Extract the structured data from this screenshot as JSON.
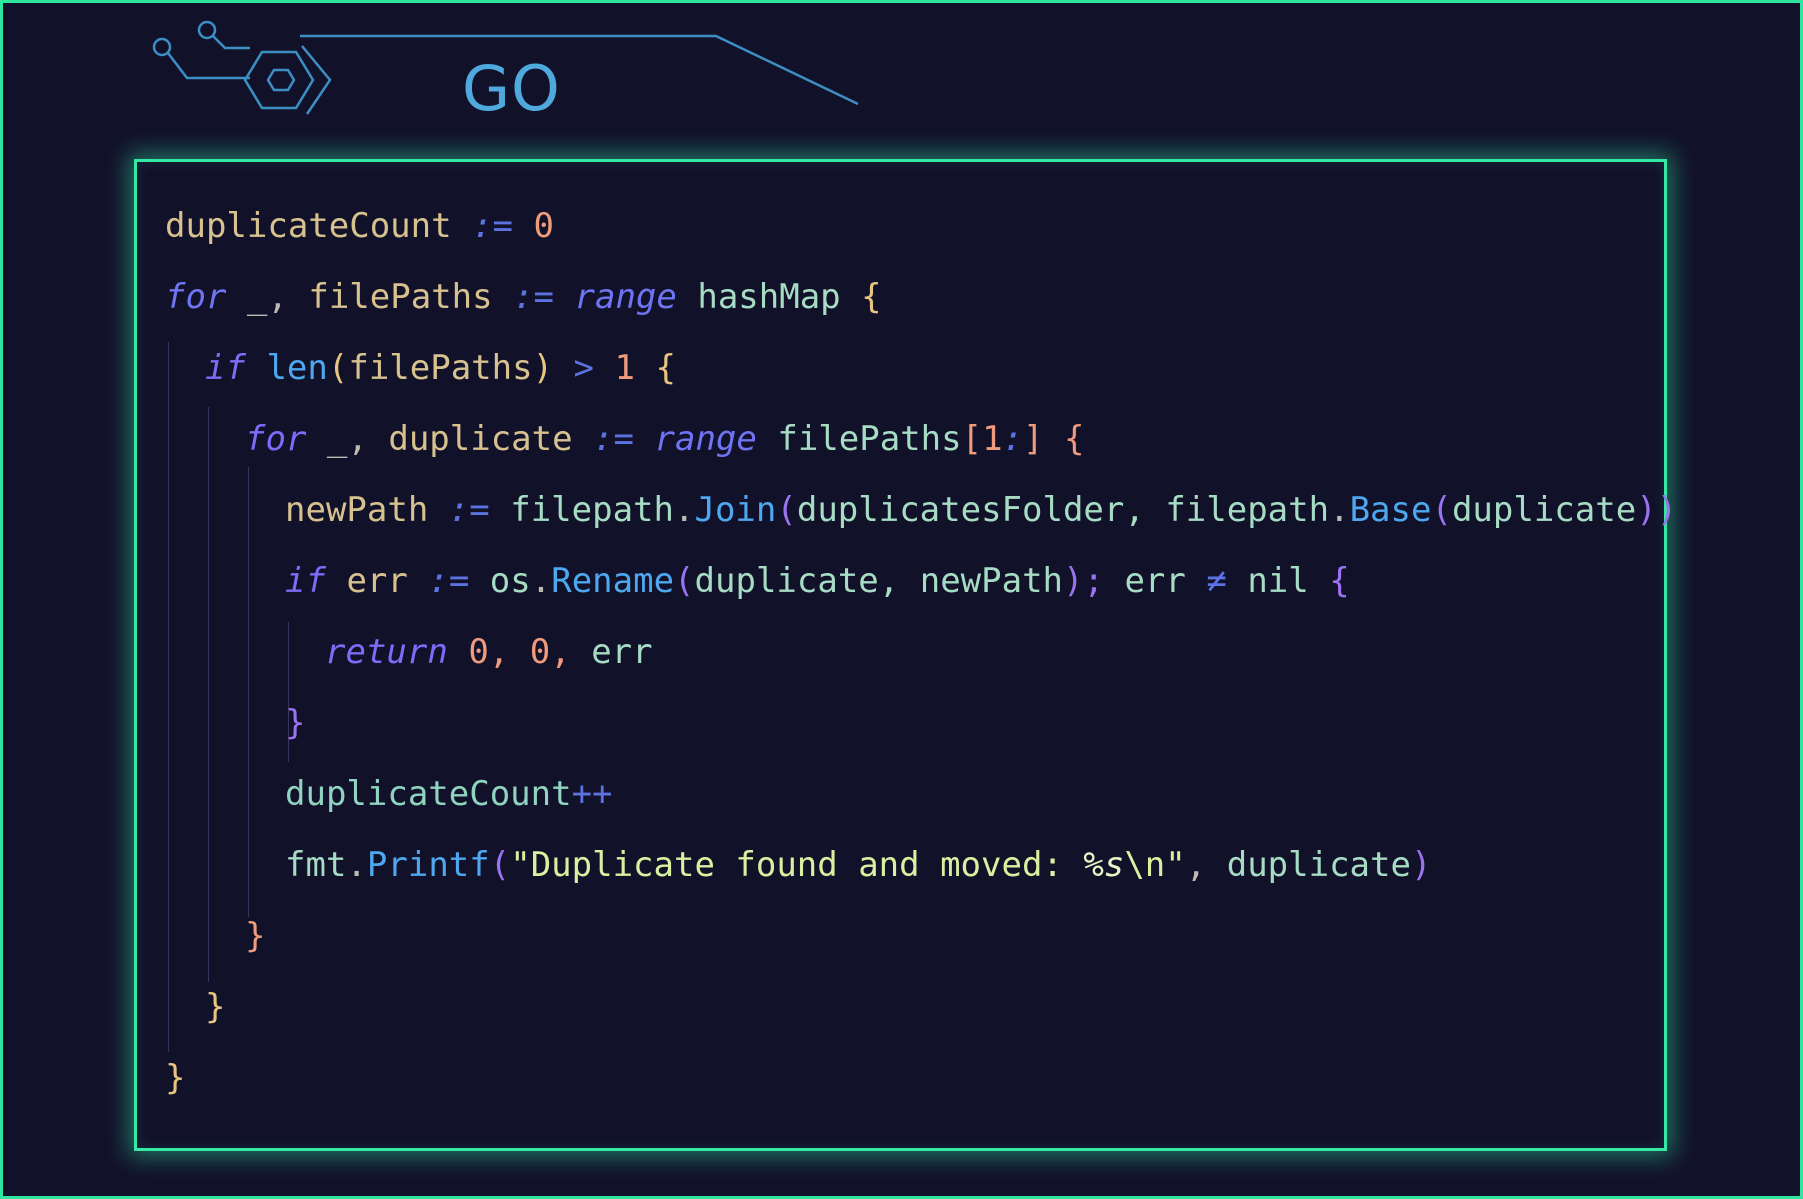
{
  "header": {
    "language_label": "GO"
  },
  "colors": {
    "accent": "#2ee6a0",
    "title": "#4fa9dd",
    "background": "#12112a"
  },
  "code": {
    "l1": {
      "a": "duplicateCount",
      "b": ":=",
      "c": "0"
    },
    "l2": {
      "a": "for",
      "b": "_,",
      "c": "filePaths",
      "d": ":=",
      "e": "range",
      "f": "hashMap",
      "g": "{"
    },
    "l3": {
      "a": "if",
      "b": "len",
      "c": "(",
      "d": "filePaths",
      "e": ")",
      "f": ">",
      "g": "1",
      "h": "{"
    },
    "l4": {
      "a": "for",
      "b": "_,",
      "c": "duplicate",
      "d": ":=",
      "e": "range",
      "f": "filePaths",
      "g": "[",
      "h": "1",
      "i": ":",
      "j": "]",
      "k": "{"
    },
    "l5": {
      "a": "newPath",
      "b": ":=",
      "c": "filepath",
      "d": ".",
      "e": "Join",
      "f": "(",
      "g": "duplicatesFolder,",
      "h": "filepath",
      "i": ".",
      "j": "Base",
      "k": "(",
      "l": "duplicate",
      "m": "))"
    },
    "l6": {
      "a": "if",
      "b": "err",
      "c": ":=",
      "d": "os",
      "e": ".",
      "f": "Rename",
      "g": "(",
      "h": "duplicate,",
      "i": "newPath",
      "j": ");",
      "k": "err",
      "l": "≠",
      "m": "nil",
      "n": "{"
    },
    "l7": {
      "a": "return",
      "b": "0,",
      "c": "0,",
      "d": "err"
    },
    "l8": {
      "a": "}"
    },
    "l9": {
      "a": "duplicateCount",
      "b": "++"
    },
    "l10": {
      "a": "fmt",
      "b": ".",
      "c": "Printf",
      "d": "(",
      "e": "\"Duplicate found and moved: ",
      "f": "%s",
      "g": "\\n\"",
      "h": ",",
      "i": "duplicate",
      "j": ")"
    },
    "l11": {
      "a": "}"
    },
    "l12": {
      "a": "}"
    },
    "l13": {
      "a": "}"
    }
  }
}
